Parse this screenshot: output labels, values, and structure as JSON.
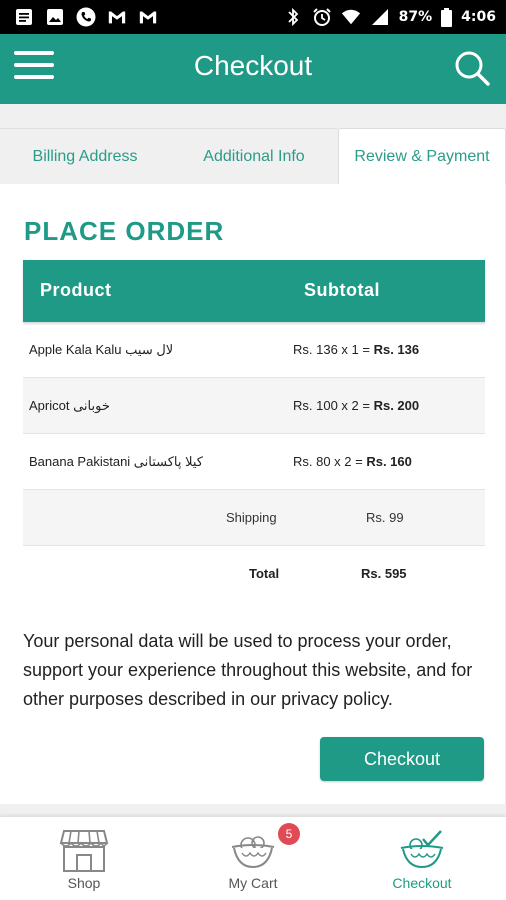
{
  "status_bar": {
    "battery_percent": "87%",
    "time": "4:06",
    "left_icons": [
      "message-icon",
      "image-icon",
      "phone-icon",
      "gmail-icon",
      "gmail-icon"
    ],
    "right_icons": [
      "bluetooth-icon",
      "alarm-icon",
      "wifi-icon",
      "signal-icon",
      "battery-icon"
    ]
  },
  "app_bar": {
    "title": "Checkout",
    "color": "#1e9a86"
  },
  "tabs": [
    {
      "label": "Billing Address",
      "active": false
    },
    {
      "label": "Additional Info",
      "active": false
    },
    {
      "label": "Review & Payment",
      "active": true
    }
  ],
  "order": {
    "heading": "PLACE ORDER",
    "columns": {
      "product": "Product",
      "subtotal": "Subtotal"
    },
    "items": [
      {
        "name": "Apple Kala Kalu لال سیب",
        "calc": "Rs. 136 x 1 = ",
        "total": "Rs. 136"
      },
      {
        "name": "Apricot خوبانی",
        "calc": "Rs. 100 x 2 = ",
        "total": "Rs. 200"
      },
      {
        "name": "Banana Pakistani کیلا پاکستانی",
        "calc": "Rs. 80 x 2 = ",
        "total": "Rs. 160"
      }
    ],
    "shipping_label": "Shipping",
    "shipping_value": "Rs. 99",
    "total_label": "Total",
    "total_value": "Rs. 595"
  },
  "privacy_text": "Your personal data will be used to process your order, support your experience throughout this website, and for other purposes described in our privacy policy.",
  "checkout_button": "Checkout",
  "bottom_nav": [
    {
      "label": "Shop",
      "icon": "shop-icon",
      "active": false
    },
    {
      "label": "My Cart",
      "icon": "cart-basket-icon",
      "active": false,
      "badge": "5"
    },
    {
      "label": "Checkout",
      "icon": "checkout-basket-icon",
      "active": true
    }
  ]
}
